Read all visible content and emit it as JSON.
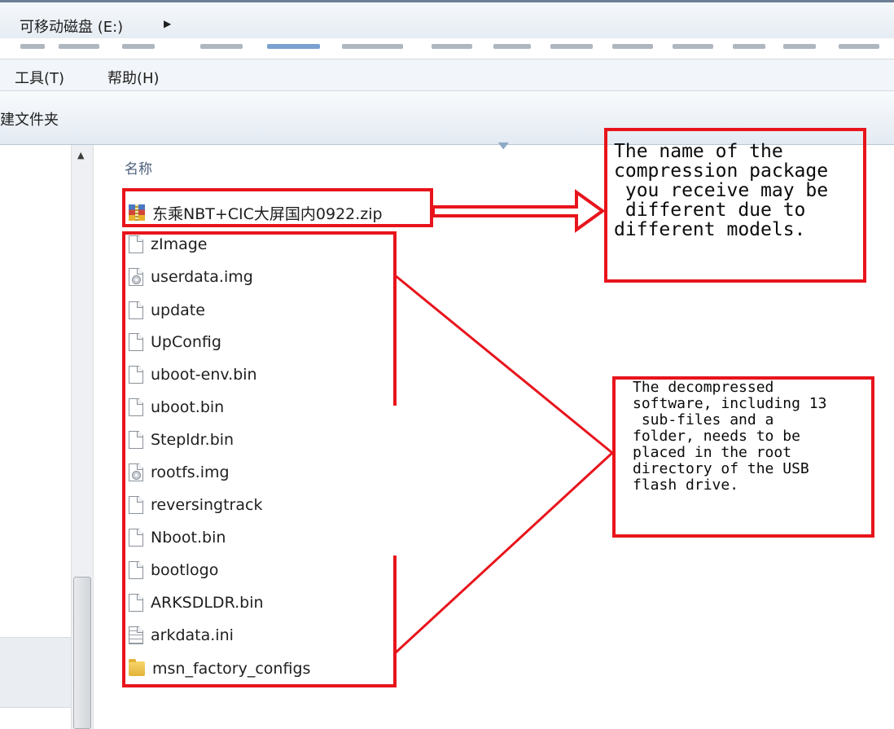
{
  "address_bar": {
    "path": "可移动磁盘 (E:)",
    "arrow_icon": "chevron-right-icon"
  },
  "menu": [
    {
      "id": "tools",
      "label": "工具(T)"
    },
    {
      "id": "help",
      "label": "帮助(H)"
    }
  ],
  "toolbar": {
    "new_folder_label": "建文件夹"
  },
  "file_list": {
    "column_header": "名称",
    "archive": {
      "name": "东乘NBT+CIC大屏国内0922.zip",
      "icon": "zip-archive-icon"
    },
    "files": [
      {
        "name": "zImage",
        "icon": "file-icon"
      },
      {
        "name": "userdata.img",
        "icon": "disc-image-icon"
      },
      {
        "name": "update",
        "icon": "file-icon"
      },
      {
        "name": "UpConfig",
        "icon": "file-icon"
      },
      {
        "name": "uboot-env.bin",
        "icon": "file-icon"
      },
      {
        "name": "uboot.bin",
        "icon": "file-icon"
      },
      {
        "name": "Stepldr.bin",
        "icon": "file-icon"
      },
      {
        "name": "rootfs.img",
        "icon": "disc-image-icon"
      },
      {
        "name": "reversingtrack",
        "icon": "file-icon"
      },
      {
        "name": "Nboot.bin",
        "icon": "file-icon"
      },
      {
        "name": "bootlogo",
        "icon": "file-icon"
      },
      {
        "name": "ARKSDLDR.bin",
        "icon": "file-icon"
      },
      {
        "name": "arkdata.ini",
        "icon": "text-file-icon"
      },
      {
        "name": "msn_factory_configs",
        "icon": "folder-icon"
      }
    ]
  },
  "annotations": {
    "archive_note": "The name of the\ncompression package\n you receive may be\n different due to\ndifferent models.",
    "files_note": "The decompressed\nsoftware, including 13\n sub-files and a\nfolder, needs to be\nplaced in the root\ndirectory of the USB\nflash drive.",
    "highlight_color": "#e8141c"
  }
}
